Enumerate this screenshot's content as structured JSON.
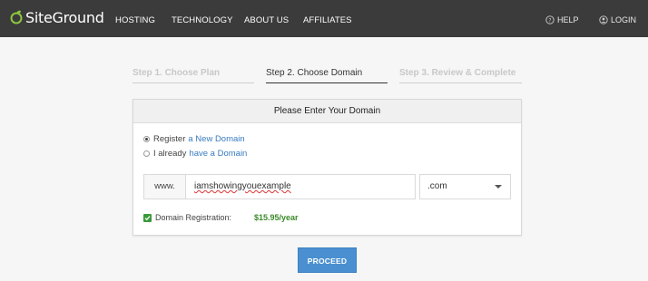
{
  "header": {
    "logo_text": "SiteGround",
    "nav": [
      "HOSTING",
      "TECHNOLOGY",
      "ABOUT US",
      "AFFILIATES"
    ],
    "help_label": "HELP",
    "login_label": "LOGIN"
  },
  "steps": [
    {
      "label": "Step 1. Choose Plan",
      "state": "inactive"
    },
    {
      "label": "Step 2. Choose Domain",
      "state": "active"
    },
    {
      "label": "Step 3. Review & Complete",
      "state": "inactive"
    }
  ],
  "panel": {
    "title": "Please Enter Your Domain",
    "option_register_prefix": "Register",
    "option_register_link": "a New Domain",
    "option_existing_prefix": "I already",
    "option_existing_link": "have a Domain",
    "www_label": "www.",
    "domain_value": "iamshowingyouexample",
    "tld_selected": ".com",
    "registration_label": "Domain Registration:",
    "registration_price": "$15.95/year"
  },
  "proceed_label": "PROCEED",
  "colors": {
    "topbar": "#3b3b3b",
    "accent_button": "#4a90d0",
    "price_green": "#3a8a2a",
    "link_blue": "#3a7bc0"
  }
}
